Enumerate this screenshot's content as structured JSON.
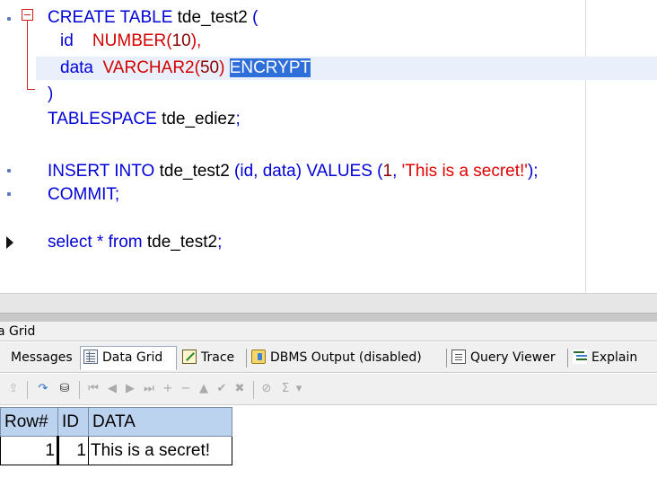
{
  "editor": {
    "lines": {
      "l1": {
        "kw1": "CREATE TABLE",
        "name": "tde_test2",
        "paren": "("
      },
      "l2": {
        "col": "id",
        "type": "NUMBER",
        "open": "(",
        "num": "10",
        "close": "),"
      },
      "l3": {
        "col": "data",
        "type": "VARCHAR2",
        "open": "(",
        "num": "50",
        "close": ")",
        "selected": "ENCRYPT"
      },
      "l4": {
        "paren": ")"
      },
      "l5": {
        "kw": "TABLESPACE",
        "name": "tde_ediez",
        "semi": ";"
      },
      "l6": {
        "kw1": "INSERT INTO",
        "name": "tde_test2",
        "cols": "(id, data)",
        "kw2": "VALUES",
        "open": "(",
        "num": "1",
        "comma": ",",
        "str": "'This is a secret!'",
        "close": ");"
      },
      "l7": {
        "kw": "COMMIT;"
      },
      "l8": {
        "kw1": "select",
        "star": "*",
        "kw2": "from",
        "name": "tde_test2",
        "semi": ";"
      }
    }
  },
  "results": {
    "panel_title": "a Grid",
    "tabs": [
      {
        "label": "Messages",
        "icon": "none"
      },
      {
        "label": "Data Grid",
        "icon": "grid-icon"
      },
      {
        "label": "Trace",
        "icon": "trace-icon"
      },
      {
        "label": "DBMS Output (disabled)",
        "icon": "dbms-output-icon"
      },
      {
        "label": "Query Viewer",
        "icon": "query-viewer-icon"
      },
      {
        "label": "Explain",
        "icon": "explain-plan-icon"
      }
    ],
    "active_tab": "Data Grid",
    "toolbar": {
      "first": "⏮",
      "prev": "◀",
      "next": "▶",
      "last": "⏭",
      "insert": "+",
      "delete": "−",
      "edit": "▲",
      "post": "✔",
      "cancel": "✖",
      "sigma": "Σ",
      "dropdown": "▾"
    },
    "grid": {
      "columns": [
        "Row#",
        "ID",
        "DATA"
      ],
      "rows": [
        {
          "rownum": "1",
          "id": "1",
          "data": "This is a secret!"
        }
      ]
    }
  }
}
